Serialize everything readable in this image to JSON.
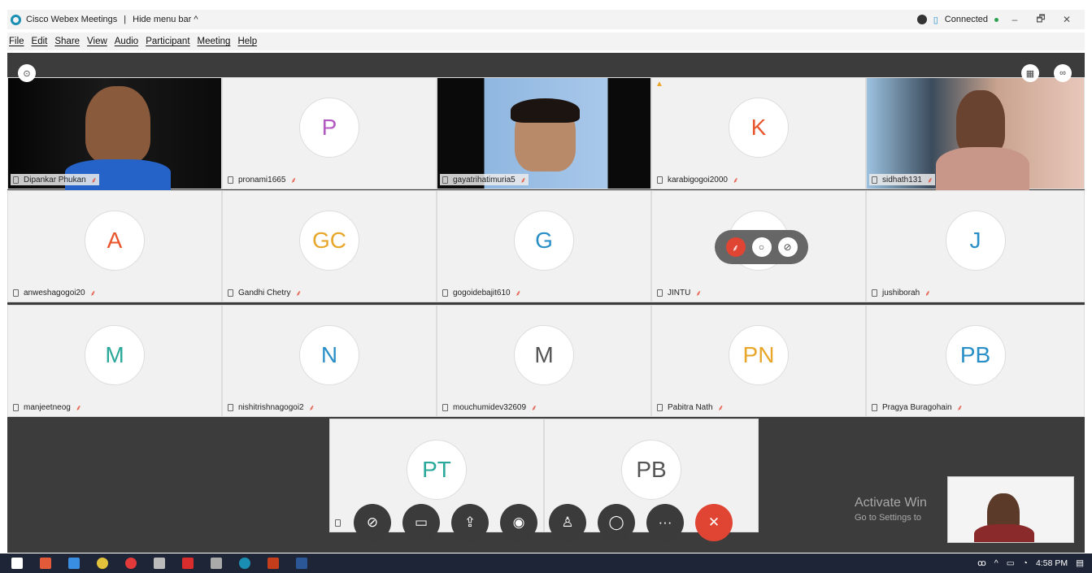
{
  "window": {
    "title": "Cisco Webex Meetings",
    "hide_menu_label": "Hide menu bar",
    "hide_menu_icon": "chevron-up-icon",
    "connection_status": "Connected",
    "minimize": "–",
    "restore": "🗗",
    "close": "✕"
  },
  "menu": [
    "File",
    "Edit",
    "Share",
    "View",
    "Audio",
    "Participant",
    "Meeting",
    "Help"
  ],
  "participants": [
    {
      "name": "Dipankar Phukan",
      "type": "video"
    },
    {
      "name": "pronami1665",
      "initials": "P",
      "color": "#b35ac2"
    },
    {
      "name": "gayatrihatimuria5",
      "type": "video"
    },
    {
      "name": "karabigogoi2000",
      "initials": "K",
      "color": "#e8552b"
    },
    {
      "name": "sidhath131",
      "type": "video"
    },
    {
      "name": "anweshagogoi20",
      "initials": "A",
      "color": "#e8552b"
    },
    {
      "name": "Gandhi Chetry",
      "initials": "GC",
      "color": "#e8a62b"
    },
    {
      "name": "gogoidebajit610",
      "initials": "G",
      "color": "#2a8fc7"
    },
    {
      "name": "JINTU",
      "initials": "",
      "color": "#e8552b"
    },
    {
      "name": "jushiborah",
      "initials": "J",
      "color": "#2a8fc7"
    },
    {
      "name": "manjeetneog",
      "initials": "M",
      "color": "#2aa89a"
    },
    {
      "name": "nishitrishnagogoi2",
      "initials": "N",
      "color": "#2a8fc7"
    },
    {
      "name": "mouchumidev32609",
      "initials": "M",
      "color": "#555555"
    },
    {
      "name": "Pabitra Nath",
      "initials": "PN",
      "color": "#e8a62b"
    },
    {
      "name": "Pragya Buragohain",
      "initials": "PB",
      "color": "#2a8fc7"
    },
    {
      "name": "",
      "initials": "PT",
      "color": "#2aa89a"
    },
    {
      "name": "",
      "initials": "PB",
      "color": "#555555"
    }
  ],
  "toolbar": {
    "mute": "mic-off-icon",
    "video": "video-off-icon",
    "share": "share-icon",
    "record": "record-icon",
    "participants": "participants-icon",
    "chat": "chat-icon",
    "more": "···",
    "end": "✕"
  },
  "hover_controls": [
    "mic-icon",
    "chat-icon",
    "block-icon"
  ],
  "activate_windows": {
    "line1": "Activate Win",
    "line2": "Go to Settings to"
  },
  "taskbar": {
    "time": "4:58 PM"
  }
}
